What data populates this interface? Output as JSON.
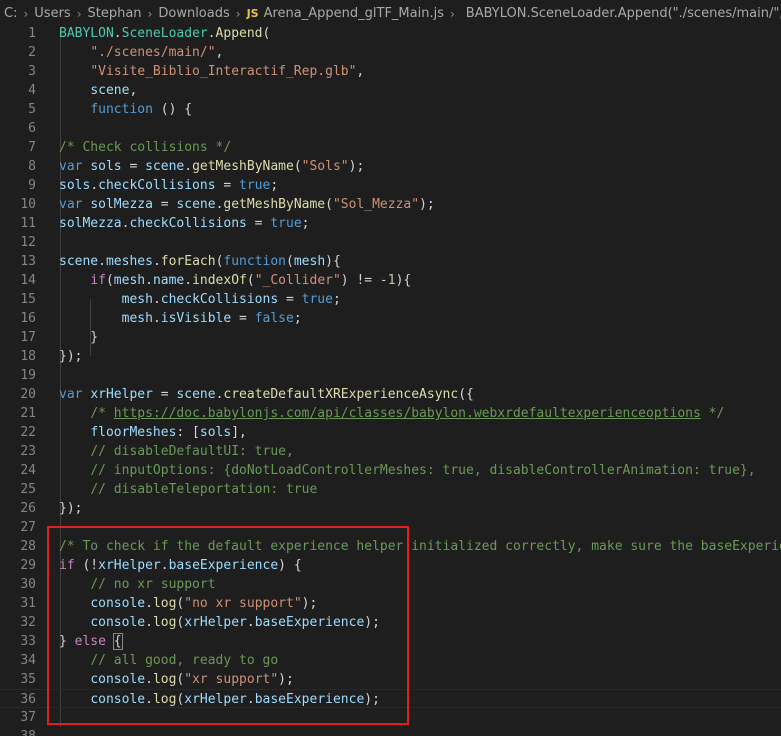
{
  "breadcrumb": {
    "parts": [
      "C:",
      "Users",
      "Stephan",
      "Downloads"
    ],
    "file_badge": "JS",
    "file_name": "Arena_Append_glTF_Main.js",
    "symbol": "BABYLON.SceneLoader.Append(\"./scenes/main/\", \"Visite_Bi"
  },
  "icons": {
    "file": "javascript-file-icon",
    "symbol": "method-cube-icon"
  },
  "colors": {
    "keyword": "#569cd6",
    "function": "#dcdcaa",
    "variable": "#9cdcfe",
    "class": "#4ec9b0",
    "string": "#ce9178",
    "number": "#b5cea8",
    "comment": "#6a9955",
    "highlight_box": "#e02020"
  },
  "code_lines": [
    {
      "n": "1",
      "tokens": [
        [
          "cls",
          "BABYLON"
        ],
        [
          "plain",
          "."
        ],
        [
          "cls",
          "SceneLoader"
        ],
        [
          "plain",
          "."
        ],
        [
          "fn",
          "Append"
        ],
        [
          "plain",
          "("
        ]
      ]
    },
    {
      "n": "2",
      "tokens": [
        [
          "plain",
          "    "
        ],
        [
          "str",
          "\"./scenes/main/\""
        ],
        [
          "plain",
          ","
        ]
      ]
    },
    {
      "n": "3",
      "tokens": [
        [
          "plain",
          "    "
        ],
        [
          "str",
          "\"Visite_Biblio_Interactif_Rep.glb\""
        ],
        [
          "plain",
          ","
        ]
      ]
    },
    {
      "n": "4",
      "tokens": [
        [
          "plain",
          "    "
        ],
        [
          "var",
          "scene"
        ],
        [
          "plain",
          ","
        ]
      ]
    },
    {
      "n": "5",
      "tokens": [
        [
          "plain",
          "    "
        ],
        [
          "kw",
          "function"
        ],
        [
          "plain",
          " () {"
        ]
      ]
    },
    {
      "n": "6",
      "tokens": []
    },
    {
      "n": "7",
      "tokens": [
        [
          "cmt",
          "/* Check collisions */"
        ]
      ]
    },
    {
      "n": "8",
      "tokens": [
        [
          "kw",
          "var"
        ],
        [
          "plain",
          " "
        ],
        [
          "var",
          "sols"
        ],
        [
          "plain",
          " = "
        ],
        [
          "var",
          "scene"
        ],
        [
          "plain",
          "."
        ],
        [
          "fn",
          "getMeshByName"
        ],
        [
          "plain",
          "("
        ],
        [
          "str",
          "\"Sols\""
        ],
        [
          "plain",
          ");"
        ]
      ]
    },
    {
      "n": "9",
      "tokens": [
        [
          "var",
          "sols"
        ],
        [
          "plain",
          "."
        ],
        [
          "var",
          "checkCollisions"
        ],
        [
          "plain",
          " = "
        ],
        [
          "kw",
          "true"
        ],
        [
          "plain",
          ";"
        ]
      ]
    },
    {
      "n": "10",
      "tokens": [
        [
          "kw",
          "var"
        ],
        [
          "plain",
          " "
        ],
        [
          "var",
          "solMezza"
        ],
        [
          "plain",
          " = "
        ],
        [
          "var",
          "scene"
        ],
        [
          "plain",
          "."
        ],
        [
          "fn",
          "getMeshByName"
        ],
        [
          "plain",
          "("
        ],
        [
          "str",
          "\"Sol_Mezza\""
        ],
        [
          "plain",
          ");"
        ]
      ]
    },
    {
      "n": "11",
      "tokens": [
        [
          "var",
          "solMezza"
        ],
        [
          "plain",
          "."
        ],
        [
          "var",
          "checkCollisions"
        ],
        [
          "plain",
          " = "
        ],
        [
          "kw",
          "true"
        ],
        [
          "plain",
          ";"
        ]
      ]
    },
    {
      "n": "12",
      "tokens": []
    },
    {
      "n": "13",
      "tokens": [
        [
          "var",
          "scene"
        ],
        [
          "plain",
          "."
        ],
        [
          "var",
          "meshes"
        ],
        [
          "plain",
          "."
        ],
        [
          "fn",
          "forEach"
        ],
        [
          "plain",
          "("
        ],
        [
          "kw",
          "function"
        ],
        [
          "plain",
          "("
        ],
        [
          "var",
          "mesh"
        ],
        [
          "plain",
          "){"
        ]
      ]
    },
    {
      "n": "14",
      "tokens": [
        [
          "plain",
          "    "
        ],
        [
          "ctrl",
          "if"
        ],
        [
          "plain",
          "("
        ],
        [
          "var",
          "mesh"
        ],
        [
          "plain",
          "."
        ],
        [
          "var",
          "name"
        ],
        [
          "plain",
          "."
        ],
        [
          "fn",
          "indexOf"
        ],
        [
          "plain",
          "("
        ],
        [
          "str",
          "\"_Collider\""
        ],
        [
          "plain",
          ") != -"
        ],
        [
          "num",
          "1"
        ],
        [
          "plain",
          "){"
        ]
      ]
    },
    {
      "n": "15",
      "tokens": [
        [
          "plain",
          "        "
        ],
        [
          "var",
          "mesh"
        ],
        [
          "plain",
          "."
        ],
        [
          "var",
          "checkCollisions"
        ],
        [
          "plain",
          " = "
        ],
        [
          "kw",
          "true"
        ],
        [
          "plain",
          ";"
        ]
      ]
    },
    {
      "n": "16",
      "tokens": [
        [
          "plain",
          "        "
        ],
        [
          "var",
          "mesh"
        ],
        [
          "plain",
          "."
        ],
        [
          "var",
          "isVisible"
        ],
        [
          "plain",
          " = "
        ],
        [
          "kw",
          "false"
        ],
        [
          "plain",
          ";"
        ]
      ]
    },
    {
      "n": "17",
      "tokens": [
        [
          "plain",
          "    }"
        ]
      ]
    },
    {
      "n": "18",
      "tokens": [
        [
          "plain",
          "});"
        ]
      ]
    },
    {
      "n": "19",
      "tokens": []
    },
    {
      "n": "20",
      "tokens": [
        [
          "kw",
          "var"
        ],
        [
          "plain",
          " "
        ],
        [
          "var",
          "xrHelper"
        ],
        [
          "plain",
          " = "
        ],
        [
          "var",
          "scene"
        ],
        [
          "plain",
          "."
        ],
        [
          "fn",
          "createDefaultXRExperienceAsync"
        ],
        [
          "plain",
          "({"
        ]
      ]
    },
    {
      "n": "21",
      "tokens": [
        [
          "plain",
          "    "
        ],
        [
          "cmt",
          "/* "
        ],
        [
          "link",
          "https://doc.babylonjs.com/api/classes/babylon.webxrdefaultexperienceoptions"
        ],
        [
          "cmt",
          " */"
        ]
      ]
    },
    {
      "n": "22",
      "tokens": [
        [
          "plain",
          "    "
        ],
        [
          "var",
          "floorMeshes"
        ],
        [
          "plain",
          ": ["
        ],
        [
          "var",
          "sols"
        ],
        [
          "plain",
          "],"
        ]
      ]
    },
    {
      "n": "23",
      "tokens": [
        [
          "plain",
          "    "
        ],
        [
          "cmt",
          "// disableDefaultUI: true,"
        ]
      ]
    },
    {
      "n": "24",
      "tokens": [
        [
          "plain",
          "    "
        ],
        [
          "cmt",
          "// inputOptions: {doNotLoadControllerMeshes: true, disableControllerAnimation: true},"
        ]
      ]
    },
    {
      "n": "25",
      "tokens": [
        [
          "plain",
          "    "
        ],
        [
          "cmt",
          "// disableTeleportation: true"
        ]
      ]
    },
    {
      "n": "26",
      "tokens": [
        [
          "plain",
          "});"
        ]
      ]
    },
    {
      "n": "27",
      "tokens": []
    },
    {
      "n": "28",
      "tokens": [
        [
          "cmt",
          "/* To check if the default experience helper initialized correctly, make sure the baseExperien"
        ]
      ]
    },
    {
      "n": "29",
      "tokens": [
        [
          "ctrl",
          "if"
        ],
        [
          "plain",
          " (!"
        ],
        [
          "var",
          "xrHelper"
        ],
        [
          "plain",
          "."
        ],
        [
          "var",
          "baseExperience"
        ],
        [
          "plain",
          ") {"
        ]
      ]
    },
    {
      "n": "30",
      "tokens": [
        [
          "plain",
          "    "
        ],
        [
          "cmt",
          "// no xr support"
        ]
      ]
    },
    {
      "n": "31",
      "tokens": [
        [
          "plain",
          "    "
        ],
        [
          "var",
          "console"
        ],
        [
          "plain",
          "."
        ],
        [
          "fn",
          "log"
        ],
        [
          "plain",
          "("
        ],
        [
          "str",
          "\"no xr support\""
        ],
        [
          "plain",
          ");"
        ]
      ]
    },
    {
      "n": "32",
      "tokens": [
        [
          "plain",
          "    "
        ],
        [
          "var",
          "console"
        ],
        [
          "plain",
          "."
        ],
        [
          "fn",
          "log"
        ],
        [
          "plain",
          "("
        ],
        [
          "var",
          "xrHelper"
        ],
        [
          "plain",
          "."
        ],
        [
          "var",
          "baseExperience"
        ],
        [
          "plain",
          ");"
        ]
      ]
    },
    {
      "n": "33",
      "tokens": [
        [
          "plain",
          "} "
        ],
        [
          "ctrl",
          "else"
        ],
        [
          "plain",
          " "
        ],
        [
          "bracket",
          "{"
        ]
      ]
    },
    {
      "n": "34",
      "tokens": [
        [
          "plain",
          "    "
        ],
        [
          "cmt",
          "// all good, ready to go"
        ]
      ]
    },
    {
      "n": "35",
      "tokens": [
        [
          "plain",
          "    "
        ],
        [
          "var",
          "console"
        ],
        [
          "plain",
          "."
        ],
        [
          "fn",
          "log"
        ],
        [
          "plain",
          "("
        ],
        [
          "str",
          "\"xr support\""
        ],
        [
          "plain",
          ");"
        ]
      ]
    },
    {
      "n": "36",
      "tokens": [
        [
          "plain",
          "    "
        ],
        [
          "var",
          "console"
        ],
        [
          "plain",
          "."
        ],
        [
          "fn",
          "log"
        ],
        [
          "plain",
          "("
        ],
        [
          "var",
          "xrHelper"
        ],
        [
          "plain",
          "."
        ],
        [
          "var",
          "baseExperience"
        ],
        [
          "plain",
          ");"
        ]
      ]
    },
    {
      "n": "37",
      "tokens": []
    },
    {
      "n": "38",
      "tokens": []
    }
  ]
}
